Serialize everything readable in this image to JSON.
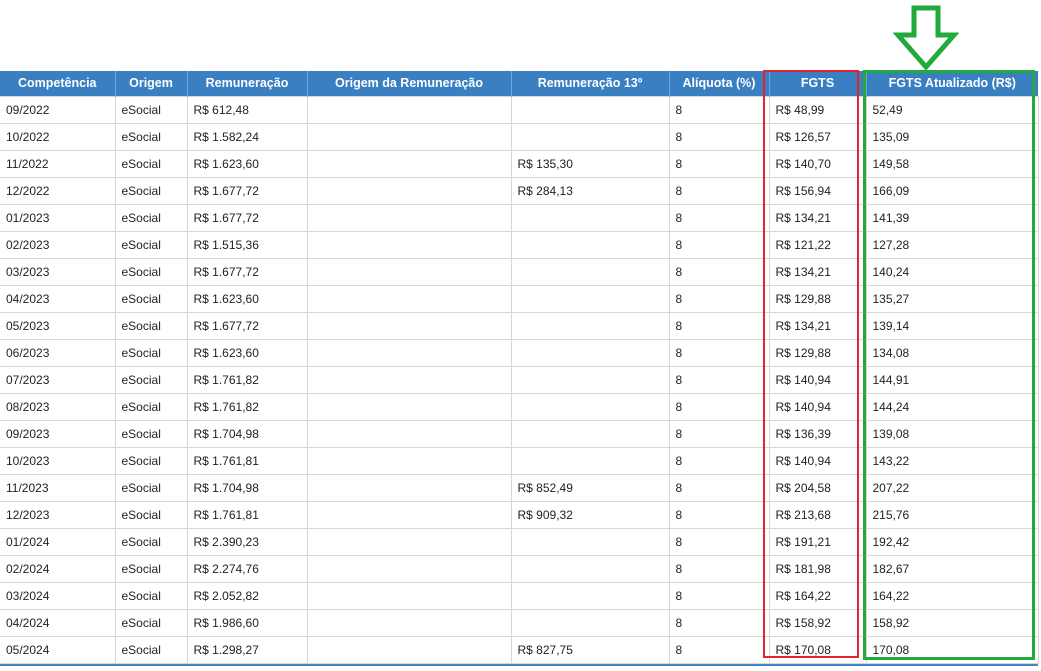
{
  "columns": [
    "Competência",
    "Origem",
    "Remuneração",
    "Origem da Remuneração",
    "Remuneração 13º",
    "Alíquota (%)",
    "FGTS",
    "FGTS Atualizado (R$)"
  ],
  "rows": [
    [
      "09/2022",
      "eSocial",
      "R$ 612,48",
      "",
      "",
      "8",
      "R$ 48,99",
      "52,49"
    ],
    [
      "10/2022",
      "eSocial",
      "R$ 1.582,24",
      "",
      "",
      "8",
      "R$ 126,57",
      "135,09"
    ],
    [
      "11/2022",
      "eSocial",
      "R$ 1.623,60",
      "",
      "R$ 135,30",
      "8",
      "R$ 140,70",
      "149,58"
    ],
    [
      "12/2022",
      "eSocial",
      "R$ 1.677,72",
      "",
      "R$ 284,13",
      "8",
      "R$ 156,94",
      "166,09"
    ],
    [
      "01/2023",
      "eSocial",
      "R$ 1.677,72",
      "",
      "",
      "8",
      "R$ 134,21",
      "141,39"
    ],
    [
      "02/2023",
      "eSocial",
      "R$ 1.515,36",
      "",
      "",
      "8",
      "R$ 121,22",
      "127,28"
    ],
    [
      "03/2023",
      "eSocial",
      "R$ 1.677,72",
      "",
      "",
      "8",
      "R$ 134,21",
      "140,24"
    ],
    [
      "04/2023",
      "eSocial",
      "R$ 1.623,60",
      "",
      "",
      "8",
      "R$ 129,88",
      "135,27"
    ],
    [
      "05/2023",
      "eSocial",
      "R$ 1.677,72",
      "",
      "",
      "8",
      "R$ 134,21",
      "139,14"
    ],
    [
      "06/2023",
      "eSocial",
      "R$ 1.623,60",
      "",
      "",
      "8",
      "R$ 129,88",
      "134,08"
    ],
    [
      "07/2023",
      "eSocial",
      "R$ 1.761,82",
      "",
      "",
      "8",
      "R$ 140,94",
      "144,91"
    ],
    [
      "08/2023",
      "eSocial",
      "R$ 1.761,82",
      "",
      "",
      "8",
      "R$ 140,94",
      "144,24"
    ],
    [
      "09/2023",
      "eSocial",
      "R$ 1.704,98",
      "",
      "",
      "8",
      "R$ 136,39",
      "139,08"
    ],
    [
      "10/2023",
      "eSocial",
      "R$ 1.761,81",
      "",
      "",
      "8",
      "R$ 140,94",
      "143,22"
    ],
    [
      "11/2023",
      "eSocial",
      "R$ 1.704,98",
      "",
      "R$ 852,49",
      "8",
      "R$ 204,58",
      "207,22"
    ],
    [
      "12/2023",
      "eSocial",
      "R$ 1.761,81",
      "",
      "R$ 909,32",
      "8",
      "R$ 213,68",
      "215,76"
    ],
    [
      "01/2024",
      "eSocial",
      "R$ 2.390,23",
      "",
      "",
      "8",
      "R$ 191,21",
      "192,42"
    ],
    [
      "02/2024",
      "eSocial",
      "R$ 2.274,76",
      "",
      "",
      "8",
      "R$ 181,98",
      "182,67"
    ],
    [
      "03/2024",
      "eSocial",
      "R$ 2.052,82",
      "",
      "",
      "8",
      "R$ 164,22",
      "164,22"
    ],
    [
      "04/2024",
      "eSocial",
      "R$ 1.986,60",
      "",
      "",
      "8",
      "R$ 158,92",
      "158,92"
    ],
    [
      "05/2024",
      "eSocial",
      "R$ 1.298,27",
      "",
      "R$ 827,75",
      "8",
      "R$ 170,08",
      "170,08"
    ]
  ],
  "colors": {
    "header_bg": "#3a7fc1",
    "fgts_highlight": "#e2242e",
    "fgts_atualizado_highlight": "#22ab3c",
    "arrow": "#22ab3c"
  },
  "icons": {
    "annotation_arrow": "down-arrow-icon"
  }
}
